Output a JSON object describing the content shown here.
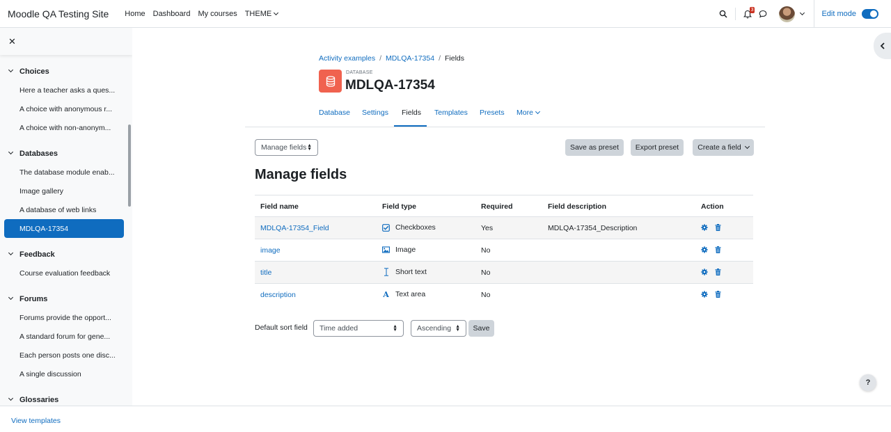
{
  "navbar": {
    "site_name": "Moodle QA Testing Site",
    "links": [
      "Home",
      "Dashboard",
      "My courses",
      "THEME"
    ],
    "notification_count": "3",
    "edit_mode_label": "Edit mode"
  },
  "drawer": {
    "sections": [
      {
        "title": "Choices",
        "items": [
          "Here a teacher asks a ques...",
          "A choice with anonymous r...",
          "A choice with non-anonym..."
        ]
      },
      {
        "title": "Databases",
        "items": [
          "The database module enab...",
          "Image gallery",
          "A database of web links",
          "MDLQA-17354"
        ]
      },
      {
        "title": "Feedback",
        "items": [
          "Course evaluation feedback"
        ]
      },
      {
        "title": "Forums",
        "items": [
          "Forums provide the opport...",
          "A standard forum for gene...",
          "Each person posts one disc...",
          "A single discussion"
        ]
      },
      {
        "title": "Glossaries",
        "items": []
      }
    ],
    "active_item": "MDLQA-17354"
  },
  "breadcrumb": [
    "Activity examples",
    "MDLQA-17354",
    "Fields"
  ],
  "module": {
    "type_label": "DATABASE",
    "title": "MDLQA-17354",
    "accent_color": "#f0624f"
  },
  "tabs": [
    "Database",
    "Settings",
    "Fields",
    "Templates",
    "Presets",
    "More"
  ],
  "active_tab": "Fields",
  "toolbar": {
    "manage_select": "Manage fields",
    "save_preset": "Save as preset",
    "export_preset": "Export preset",
    "create_field": "Create a field"
  },
  "heading": "Manage fields",
  "table": {
    "headers": [
      "Field name",
      "Field type",
      "Required",
      "Field description",
      "Action"
    ],
    "rows": [
      {
        "name": "MDLQA-17354_Field",
        "type": "Checkboxes",
        "type_icon": "checkbox-icon",
        "required": "Yes",
        "description": "MDLQA-17354_Description"
      },
      {
        "name": "image",
        "type": "Image",
        "type_icon": "image-icon",
        "required": "No",
        "description": ""
      },
      {
        "name": "title",
        "type": "Short text",
        "type_icon": "text-cursor-icon",
        "required": "No",
        "description": ""
      },
      {
        "name": "description",
        "type": "Text area",
        "type_icon": "textarea-icon",
        "required": "No",
        "description": ""
      }
    ]
  },
  "sort": {
    "label": "Default sort field",
    "field_value": "Time added",
    "order_value": "Ascending",
    "save_label": "Save"
  },
  "footer": {
    "view_templates": "View templates"
  },
  "help_label": "?",
  "colors": {
    "primary": "#0f6cbf",
    "button_grey": "#ced4da"
  }
}
